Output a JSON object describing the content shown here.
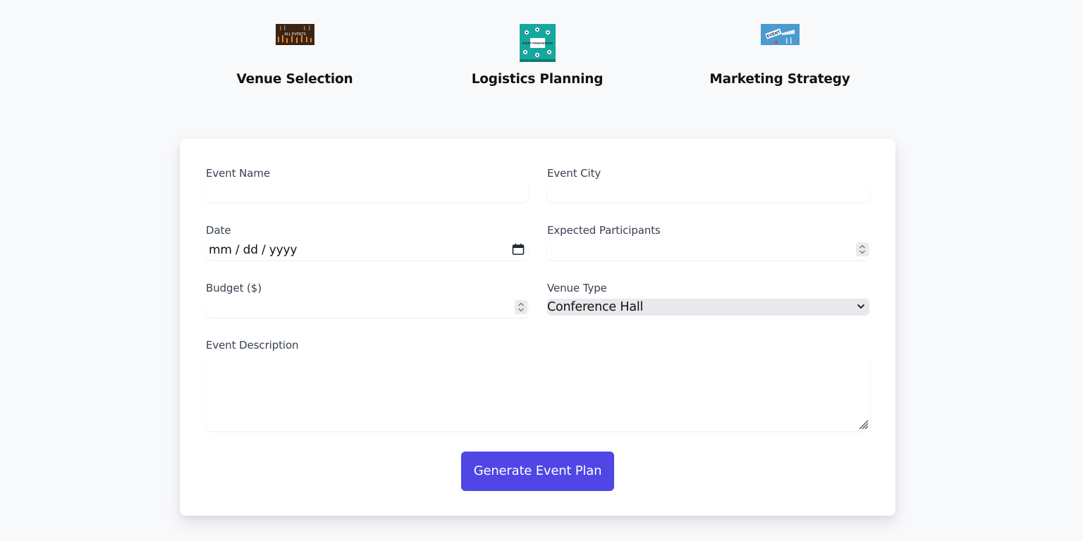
{
  "features": [
    {
      "title": "Venue Selection",
      "image_icon": "all-events-photo",
      "image_text": "ALL EVENTS"
    },
    {
      "title": "Logistics Planning",
      "image_icon": "event-management-illustration",
      "image_text": "EVENT MANAGEMENT"
    },
    {
      "title": "Marketing Strategy",
      "image_icon": "event-promotion-illustration",
      "image_text": "EVENT"
    }
  ],
  "form": {
    "event_name": {
      "label": "Event Name",
      "value": ""
    },
    "event_city": {
      "label": "Event City",
      "value": ""
    },
    "date": {
      "label": "Date",
      "placeholder": "mm / dd / yyyy"
    },
    "expected_participants": {
      "label": "Expected Participants",
      "value": ""
    },
    "budget": {
      "label": "Budget ($)",
      "value": ""
    },
    "venue_type": {
      "label": "Venue Type",
      "selected": "Conference Hall"
    },
    "event_description": {
      "label": "Event Description",
      "value": ""
    },
    "submit_label": "Generate Event Plan"
  },
  "colors": {
    "page_background": "#f8f9fb",
    "card_background": "#ffffff",
    "primary_button": "#4f46e5",
    "label_text": "#374151"
  }
}
